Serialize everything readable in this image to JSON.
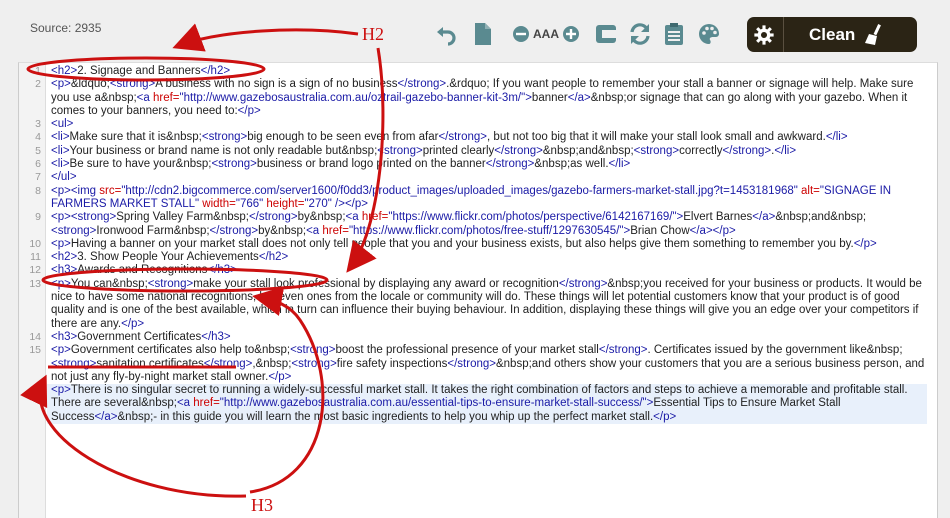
{
  "source": {
    "label": "Source: 2935"
  },
  "toolbar": {
    "icons": [
      "undo-icon",
      "new-document-icon",
      "decrease-font-icon",
      "font-size-icon",
      "increase-font-icon",
      "wrap-icon",
      "refresh-icon",
      "clipboard-icon",
      "palette-icon"
    ],
    "font_size_label": "AAA",
    "clean_label": "Clean"
  },
  "annotations": {
    "h2_label": "H2",
    "h3_label": "H3",
    "color": "#cc1010"
  },
  "code": {
    "l1": {
      "num": "1",
      "t0": "<h2>",
      "t1": "2. Signage and Banners",
      "t2": "</h2>"
    },
    "l2": {
      "num": "2",
      "t0": "<p>",
      "t1": "&ldquo;",
      "t2": "<strong>",
      "t3": "A business with no sign is a sign of no business",
      "t4": "</strong>",
      "t5": ".&rdquo; If you want people to remember your stall a banner or signage will help. Make sure you use a&nbsp;",
      "t6": "<a ",
      "t7": "href=",
      "t8": "\"http://www.gazebosaustralia.com.au/oztrail-gazebo-banner-kit-3m/\"",
      "t9": ">",
      "t10": "banner",
      "t11": "</a>",
      "t12": "&nbsp;or signage that can go along with your gazebo. When it comes to your banners, you need to:",
      "t13": "</p>"
    },
    "l3": {
      "num": "3",
      "t0": "<ul>"
    },
    "l4": {
      "num": "4",
      "t0": "<li>",
      "t1": "Make sure that it is&nbsp;",
      "t2": "<strong>",
      "t3": "big enough to be seen even from afar",
      "t4": "</strong>",
      "t5": ", but not too big that it will make your stall look small and awkward.",
      "t6": "</li>"
    },
    "l5": {
      "num": "5",
      "t0": "<li>",
      "t1": "Your business or brand name is not only readable but&nbsp;",
      "t2": "<strong>",
      "t3": "printed clearly",
      "t4": "</strong>",
      "t5": "&nbsp;and&nbsp;",
      "t6": "<strong>",
      "t7": "correctly",
      "t8": "</strong>",
      "t9": ".",
      "t10": "</li>"
    },
    "l6": {
      "num": "6",
      "t0": "<li>",
      "t1": "Be sure to have your&nbsp;",
      "t2": "<strong>",
      "t3": "business or brand logo printed on the banner",
      "t4": "</strong>",
      "t5": "&nbsp;as well.",
      "t6": "</li>"
    },
    "l7": {
      "num": "7",
      "t0": "</ul>"
    },
    "l8": {
      "num": "8",
      "t0": "<p>",
      "t1": "<img ",
      "t2": "src=",
      "t3": "\"http://cdn2.bigcommerce.com/server1600/f0dd3/product_images/uploaded_images/gazebo-farmers-market-stall.jpg?t=1453181968\"",
      "t4": " alt=",
      "t5": "\"SIGNAGE IN FARMERS MARKET STALL\"",
      "t6": " width=",
      "t7": "\"766\"",
      "t8": " height=",
      "t9": "\"270\"",
      "t10": " />",
      "t11": "</p>"
    },
    "l9": {
      "num": "9",
      "t0": "<p>",
      "t1": "<strong>",
      "t2": "Spring Valley Farm&nbsp;",
      "t3": "</strong>",
      "t4": "by&nbsp;",
      "t5": "<a ",
      "t6": "href=",
      "t7": "\"https://www.flickr.com/photos/perspective/6142167169/\"",
      "t8": ">",
      "t9": "Elvert Barnes",
      "t10": "</a>",
      "t11": "&nbsp;and&nbsp;",
      "t12": "<strong>",
      "t13": "Ironwood Farm&nbsp;",
      "t14": "</strong>",
      "t15": "by&nbsp;",
      "t16": "<a ",
      "t17": "href=",
      "t18": "\"https://www.flickr.com/photos/free-stuff/1297630545/\"",
      "t19": ">",
      "t20": "Brian Chow",
      "t21": "</a>",
      "t22": "</p>"
    },
    "l10": {
      "num": "10",
      "t0": "<p>",
      "t1": "Having a banner on your market stall does not only tell people that you and your business exists, but also helps give them something to remember you by.",
      "t2": "</p>"
    },
    "l11": {
      "num": "11",
      "t0": "<h2>",
      "t1": "3. Show People Your Achievements",
      "t2": "</h2>"
    },
    "l12": {
      "num": "12",
      "t0": "<h3>",
      "t1": "Awards and Recognitions",
      "t2": "</h3>"
    },
    "l13": {
      "num": "13",
      "t0": "<p>",
      "t1": "You can&nbsp;",
      "t2": "<strong>",
      "t3": "make your stall look professional by displaying any award or recognition",
      "t4": "</strong>",
      "t5": "&nbsp;you received for your business or products. It would be nice to have some national recognitions, but even ones from the locale or community will do. These things will let potential customers know that your product is of good quality and is one of the best available, which in turn can influence their buying behaviour. In addition, displaying these things will give you an edge over your competitors if there are any.",
      "t6": "</p>"
    },
    "l14": {
      "num": "14",
      "t0": "<h3>",
      "t1": "Government Certificates",
      "t2": "</h3>"
    },
    "l15": {
      "num": "15",
      "t0": "<p>",
      "t1": "Government certificates also help to&nbsp;",
      "t2": "<strong>",
      "t3": "boost the professional presence of your market stall",
      "t4": "</strong>",
      "t5": ". Certificates issued by the government like&nbsp;",
      "t6": "<strong>",
      "t7": "sanitation certificates",
      "t8": "</strong>",
      "t9": ",&nbsp;",
      "t10": "<strong>",
      "t11": "fire safety inspections",
      "t12": "</strong>",
      "t13": "&nbsp;and others show your customers that you are a serious business person, and not just any fly-by-night market stall owner.",
      "t14": "</p>"
    },
    "l16": {
      "num": "16",
      "t0": "<p>",
      "t1": "There is no singular secret to running a widely-successful market stall. It takes the right combination of factors and steps to achieve a memorable and profitable stall. There are several&nbsp;",
      "t2": "<a ",
      "t3": "href=",
      "t4": "\"http://www.gazebosaustralia.com.au/essential-tips-to-ensure-market-stall-success/\"",
      "t5": ">",
      "t6": "Essential Tips to Ensure Market Stall Success",
      "t7": "</a>",
      "t8": "&nbsp;- in this guide you will learn the most basic ingredients to help you whip up the perfect market stall.",
      "t9": "</p>"
    }
  }
}
